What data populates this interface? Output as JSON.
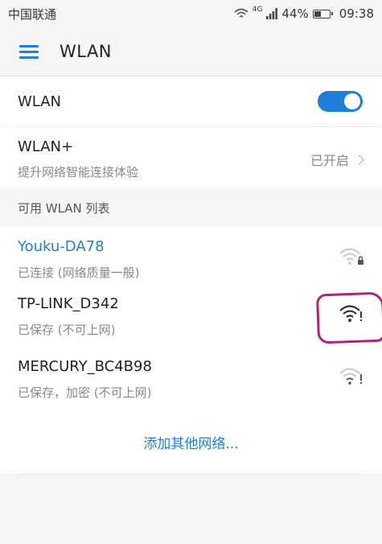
{
  "status_bar": {
    "carrier": "中国联通",
    "network_type": "4G",
    "battery": "44%",
    "time": "09:38"
  },
  "app_bar": {
    "title": "WLAN"
  },
  "wlan": {
    "label": "WLAN",
    "enabled": true
  },
  "wlan_plus": {
    "label": "WLAN+",
    "subtitle": "提升网络智能连接体验",
    "value": "已开启"
  },
  "available_header": "可用 WLAN 列表",
  "networks": [
    {
      "name": "Youku-DA78",
      "status": "已连接 (网络质量一般)",
      "icon": "wifi-lock-icon"
    },
    {
      "name": "TP-LINK_D342",
      "status": "已保存 (不可上网)",
      "icon": "wifi-exclamation-icon"
    },
    {
      "name": "MERCURY_BC4B98",
      "status": "已保存，加密 (不可上网)",
      "icon": "wifi-exclamation-icon"
    }
  ],
  "add_network": "添加其他网络...",
  "colors": {
    "accent": "#1f7fd6",
    "annotation": "#b0247a"
  }
}
